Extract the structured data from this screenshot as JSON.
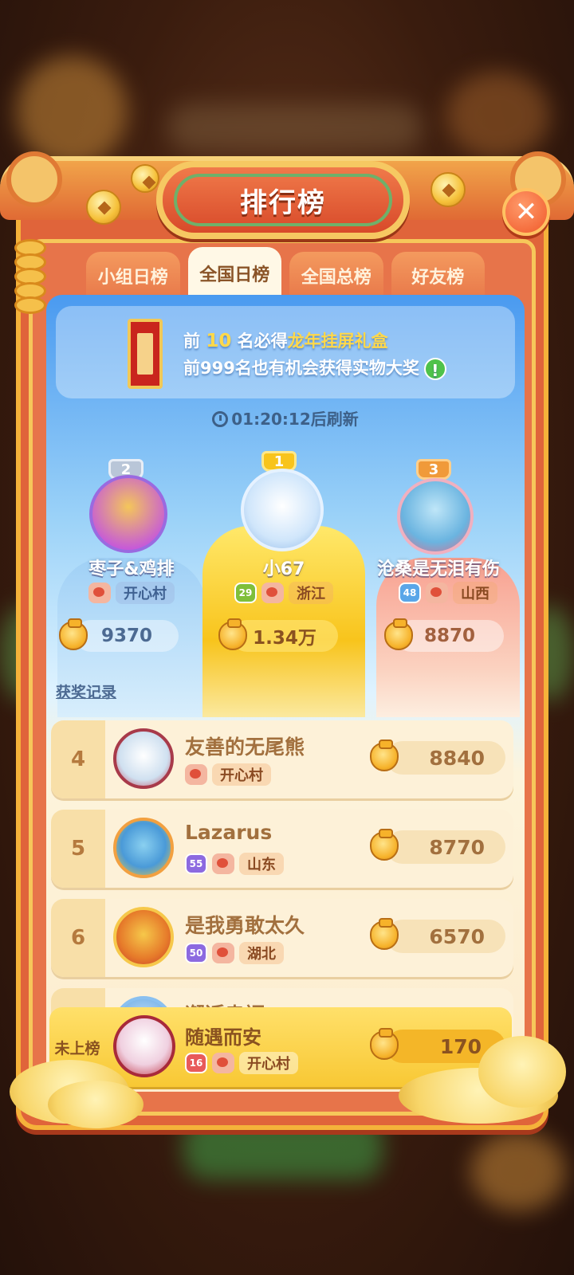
{
  "header": {
    "title": "排行榜",
    "close_icon": "close-icon"
  },
  "tabs": [
    {
      "label": "小组日榜",
      "active": false
    },
    {
      "label": "全国日榜",
      "active": true
    },
    {
      "label": "全国总榜",
      "active": false
    },
    {
      "label": "好友榜",
      "active": false
    }
  ],
  "info": {
    "line1_prefix": "前",
    "line1_num": "10",
    "line1_mid": "名必得",
    "line1_gift": "龙年挂屏礼盒",
    "line2": "前999名也有机会获得实物大奖",
    "more_icon": "!"
  },
  "refresh_text": "01:20:12后刷新",
  "podium": [
    {
      "rank": "2",
      "name": "枣子&鸡排",
      "level": "",
      "location": "开心村",
      "score": "9370"
    },
    {
      "rank": "1",
      "name": "小67",
      "level": "29",
      "location": "浙江",
      "score": "1.34万"
    },
    {
      "rank": "3",
      "name": "沧桑是无泪有伤",
      "level": "48",
      "location": "山西",
      "score": "8870"
    }
  ],
  "history_link": "获奖记录",
  "rows": [
    {
      "rank": "4",
      "name": "友善的无尾熊",
      "level": "",
      "location": "开心村",
      "score": "8840"
    },
    {
      "rank": "5",
      "name": "Lazarus",
      "level": "55",
      "location": "山东",
      "score": "8770"
    },
    {
      "rank": "6",
      "name": "是我勇敢太久",
      "level": "50",
      "location": "湖北",
      "score": "6570"
    }
  ],
  "peek_row": {
    "name": "邂逅幸福"
  },
  "my_row": {
    "rank_label": "未上榜",
    "name": "随遇而安",
    "level": "16",
    "location": "开心村",
    "score": "170"
  },
  "colors": {
    "accent": "#e0643a",
    "gold": "#f8c834",
    "sky": "#4a9af0"
  }
}
